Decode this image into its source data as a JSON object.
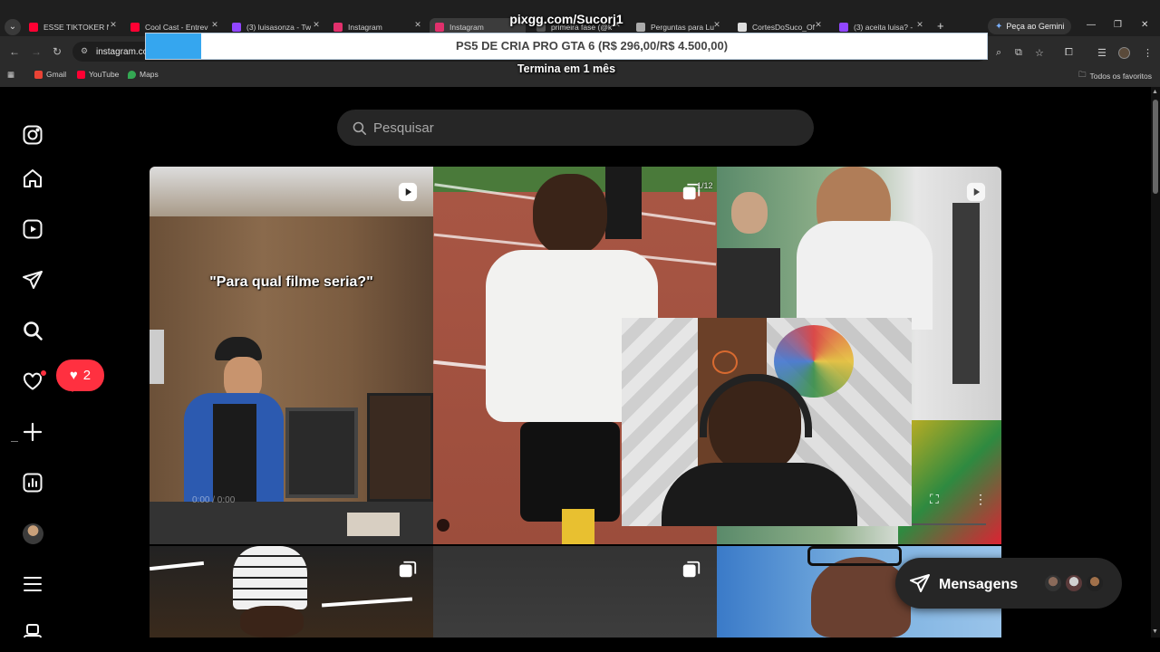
{
  "browser": {
    "tabs": [
      {
        "title": "ESSE TIKTOKER N/",
        "favicon_color": "#ff0033",
        "active": false
      },
      {
        "title": "Cool Cast - Entrev",
        "favicon_color": "#ff0033",
        "active": false
      },
      {
        "title": "(3) luisasonza - Tw",
        "favicon_color": "#9146ff",
        "active": false
      },
      {
        "title": "Instagram",
        "favicon_color": "#e1306c",
        "active": false
      },
      {
        "title": "Instagram",
        "favicon_color": "#e1306c",
        "active": true
      },
      {
        "title": "primeira fase (@k",
        "favicon_color": "#555555",
        "active": false
      },
      {
        "title": "Perguntas para Lu",
        "favicon_color": "#aaaaaa",
        "active": false
      },
      {
        "title": "CortesDoSuco_Of",
        "favicon_color": "#dddddd",
        "active": false
      },
      {
        "title": "(3) aceita luisa? -",
        "favicon_color": "#9146ff",
        "active": false
      }
    ],
    "new_tab": "+",
    "gemini_label": "Peça ao Gemini",
    "url": "instagram.com",
    "bookmarks": [
      {
        "label": "Gmail",
        "color": "#ea4335"
      },
      {
        "label": "YouTube",
        "color": "#ff0033"
      },
      {
        "label": "Maps",
        "color": "#34a853"
      }
    ],
    "favorites_label": "Todos os favoritos"
  },
  "stream_overlay": {
    "donation_link": "pixgg.com/Sucorj1",
    "goal_text": "PS5 DE CRIA PRO GTA 6 (R$ 296,00/R$ 4.500,00)",
    "goal_progress": 0.066,
    "goal_accent": "#35a6ef",
    "ends_text": "Termina em 1 mês"
  },
  "instagram": {
    "nav_icons": [
      "instagram-logo-icon",
      "home-icon",
      "reels-icon",
      "direct-icon",
      "search-icon",
      "heart-icon",
      "create-icon",
      "dashboard-icon",
      "profile-avatar",
      "menu-icon",
      "threads-icon"
    ],
    "search_placeholder": "Pesquisar",
    "notification_count": "2",
    "notification_color": "#ff3040",
    "posts": [
      {
        "caption": "\"Para qual filme seria?\"",
        "type": "reel",
        "overlay_text": "0:00 / 0:00"
      },
      {
        "type": "carousel",
        "counter": "1/12"
      },
      {
        "type": "reel"
      },
      {
        "type": "carousel"
      },
      {
        "type": "carousel"
      },
      {
        "type": "photo"
      }
    ],
    "messages_label": "Mensagens"
  }
}
